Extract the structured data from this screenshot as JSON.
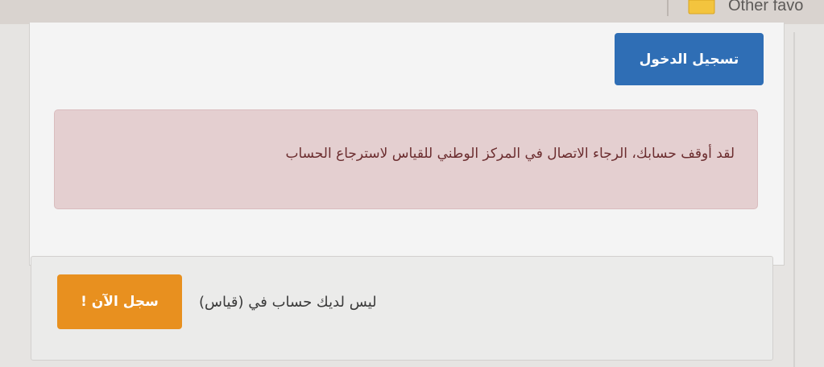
{
  "bookmarks_bar": {
    "other_favorites_label": "Other favo",
    "folder_color": "#f3c43e"
  },
  "login": {
    "button_label": "تسجيل الدخول",
    "button_color": "#2f6eb5"
  },
  "alert": {
    "message": "لقد أوقف حسابك، الرجاء الاتصال في المركز الوطني للقياس لاسترجاع الحساب",
    "background_color": "#e4cfd0"
  },
  "register": {
    "prompt": "ليس لديك حساب في (قياس)",
    "button_label": "سجل الآن !",
    "button_color": "#e8901f"
  }
}
